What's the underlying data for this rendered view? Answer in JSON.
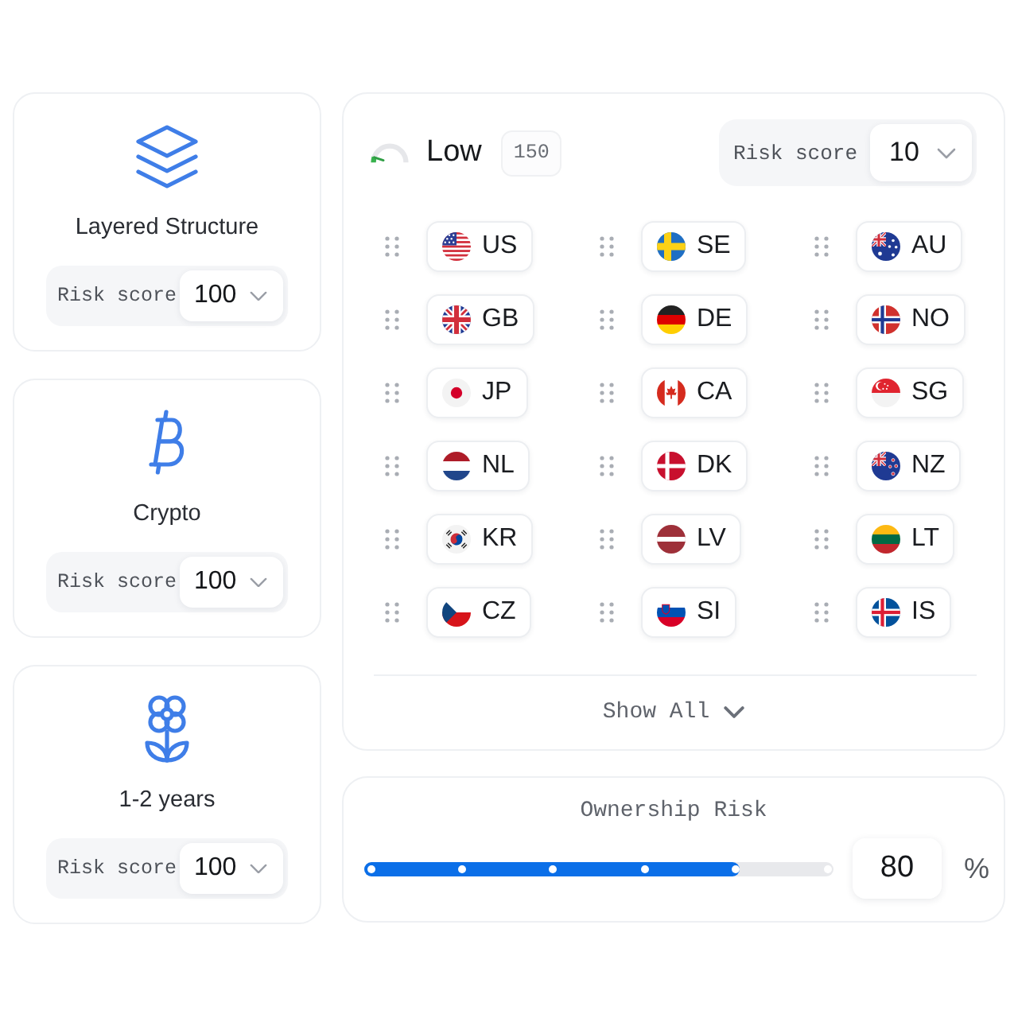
{
  "categories": [
    {
      "kind": "layers",
      "title": "Layered Structure",
      "risk_label": "Risk score",
      "risk_value": "100"
    },
    {
      "kind": "coin",
      "title": "Crypto",
      "risk_label": "Risk score",
      "risk_value": "100"
    },
    {
      "kind": "flower",
      "title": "1-2 years",
      "risk_label": "Risk score",
      "risk_value": "100"
    }
  ],
  "country_panel": {
    "rating": {
      "label": "Low",
      "level": 0.1,
      "badge": "150"
    },
    "risk": {
      "label": "Risk score",
      "value": "10"
    },
    "countries": [
      {
        "kind": "us",
        "code": "US"
      },
      {
        "kind": "se",
        "code": "SE"
      },
      {
        "kind": "au",
        "code": "AU"
      },
      {
        "kind": "gb",
        "code": "GB"
      },
      {
        "kind": "de",
        "code": "DE"
      },
      {
        "kind": "no",
        "code": "NO"
      },
      {
        "kind": "jp",
        "code": "JP"
      },
      {
        "kind": "ca",
        "code": "CA"
      },
      {
        "kind": "sg",
        "code": "SG"
      },
      {
        "kind": "nl",
        "code": "NL"
      },
      {
        "kind": "dk",
        "code": "DK"
      },
      {
        "kind": "nz",
        "code": "NZ"
      },
      {
        "kind": "kr",
        "code": "KR"
      },
      {
        "kind": "lv",
        "code": "LV"
      },
      {
        "kind": "lt",
        "code": "LT"
      },
      {
        "kind": "cz",
        "code": "CZ"
      },
      {
        "kind": "si",
        "code": "SI"
      },
      {
        "kind": "is",
        "code": "IS"
      }
    ],
    "show_all": "Show All"
  },
  "ownership": {
    "title": "Ownership Risk",
    "level": 0.8,
    "value": "80",
    "unit": "%"
  }
}
